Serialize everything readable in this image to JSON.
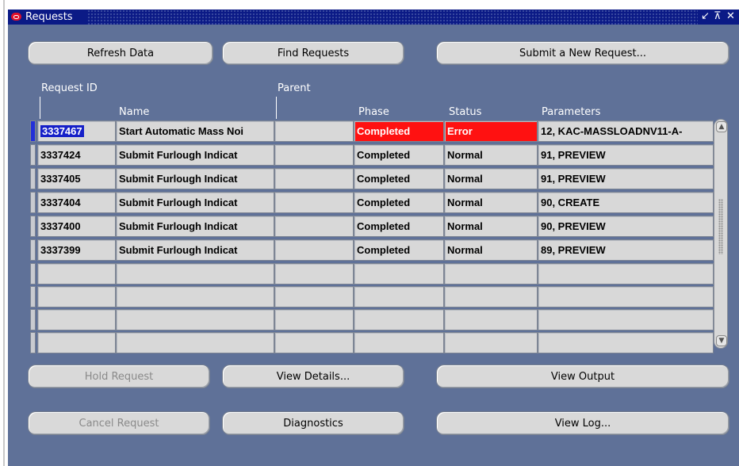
{
  "window": {
    "title": "Requests",
    "controls": [
      "↙",
      "⊼",
      "✕"
    ]
  },
  "top_buttons": {
    "refresh": "Refresh Data",
    "find": "Find Requests",
    "submit": "Submit a New Request..."
  },
  "columns": {
    "request_id": "Request ID",
    "name": "Name",
    "parent": "Parent",
    "phase": "Phase",
    "status": "Status",
    "parameters": "Parameters"
  },
  "rows": [
    {
      "id": "3337467",
      "name": "Start Automatic Mass Noi",
      "parent": "",
      "phase": "Completed",
      "status": "Error",
      "parameters": "12, KAC-MASSLOADNV11-A-"
    },
    {
      "id": "3337424",
      "name": "Submit Furlough Indicat",
      "parent": "",
      "phase": "Completed",
      "status": "Normal",
      "parameters": "91, PREVIEW"
    },
    {
      "id": "3337405",
      "name": "Submit Furlough Indicat",
      "parent": "",
      "phase": "Completed",
      "status": "Normal",
      "parameters": "91, PREVIEW"
    },
    {
      "id": "3337404",
      "name": "Submit Furlough Indicat",
      "parent": "",
      "phase": "Completed",
      "status": "Normal",
      "parameters": "90, CREATE"
    },
    {
      "id": "3337400",
      "name": "Submit Furlough Indicat",
      "parent": "",
      "phase": "Completed",
      "status": "Normal",
      "parameters": "90, PREVIEW"
    },
    {
      "id": "3337399",
      "name": "Submit Furlough Indicat",
      "parent": "",
      "phase": "Completed",
      "status": "Normal",
      "parameters": "89, PREVIEW"
    },
    {
      "id": "",
      "name": "",
      "parent": "",
      "phase": "",
      "status": "",
      "parameters": ""
    },
    {
      "id": "",
      "name": "",
      "parent": "",
      "phase": "",
      "status": "",
      "parameters": ""
    },
    {
      "id": "",
      "name": "",
      "parent": "",
      "phase": "",
      "status": "",
      "parameters": ""
    },
    {
      "id": "",
      "name": "",
      "parent": "",
      "phase": "",
      "status": "",
      "parameters": ""
    }
  ],
  "bottom_buttons": {
    "hold": "Hold Request",
    "details": "View Details...",
    "output": "View Output",
    "cancel": "Cancel Request",
    "diagnostics": "Diagnostics",
    "log": "View Log..."
  },
  "colors": {
    "window_bg": "#5f7198",
    "titlebar": "#0b1a86",
    "error_highlight": "#ff1111"
  }
}
